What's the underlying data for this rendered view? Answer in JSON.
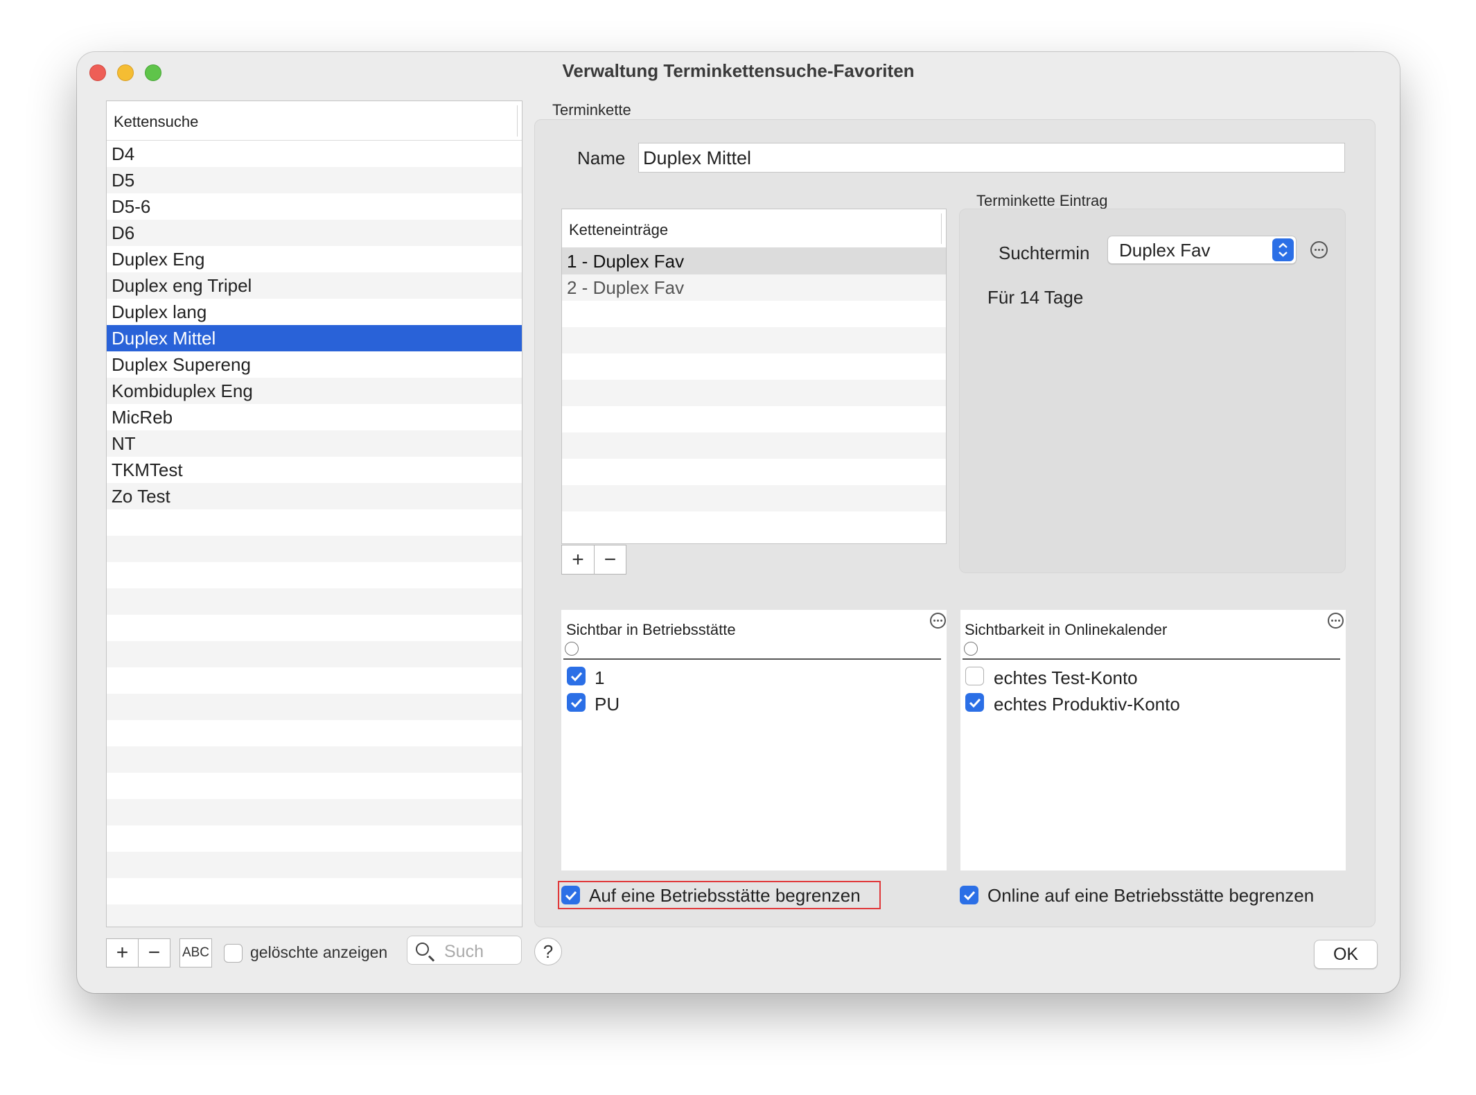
{
  "window": {
    "title": "Verwaltung Terminkettensuche-Favoriten"
  },
  "left_list": {
    "header": "Kettensuche",
    "items": [
      "D4",
      "D5",
      "D5-6",
      "D6",
      "Duplex Eng",
      "Duplex eng Tripel",
      "Duplex lang",
      "Duplex Mittel",
      "Duplex Supereng",
      "Kombiduplex Eng",
      "MicReb",
      "NT",
      "TKMTest",
      "Zo Test"
    ],
    "selected": "Duplex Mittel"
  },
  "bottom_bar": {
    "add": "+",
    "remove": "−",
    "abc": "ABC",
    "show_deleted_label": "gelöschte anzeigen",
    "search_placeholder": "Such",
    "help": "?",
    "ok": "OK"
  },
  "terminkette": {
    "group_label": "Terminkette",
    "name_label": "Name",
    "name_value": "Duplex Mittel",
    "entries": {
      "header": "Ketteneinträge",
      "items": [
        "1 - Duplex Fav",
        "2 - Duplex Fav"
      ],
      "add": "+",
      "remove": "−"
    },
    "entry": {
      "group_label": "Terminkette Eintrag",
      "suchtermin_label": "Suchtermin",
      "suchtermin_value": "Duplex Fav",
      "duration_text": "Für 14 Tage"
    },
    "visible_sites": {
      "header": "Sichtbar in Betriebsstätte",
      "items": [
        {
          "label": "1",
          "checked": true
        },
        {
          "label": "PU",
          "checked": true
        }
      ],
      "limit_label": "Auf eine Betriebsstätte begrenzen",
      "limit_checked": true
    },
    "visible_online": {
      "header": "Sichtbarkeit in Onlinekalender",
      "items": [
        {
          "label": "echtes Test-Konto",
          "checked": false
        },
        {
          "label": "echtes Produktiv-Konto",
          "checked": true
        }
      ],
      "limit_label": "Online auf eine Betriebsstätte begrenzen",
      "limit_checked": true
    }
  },
  "colors": {
    "selection": "#2962d8",
    "checkbox": "#2b6fe6",
    "highlight_border": "#e0383a"
  }
}
